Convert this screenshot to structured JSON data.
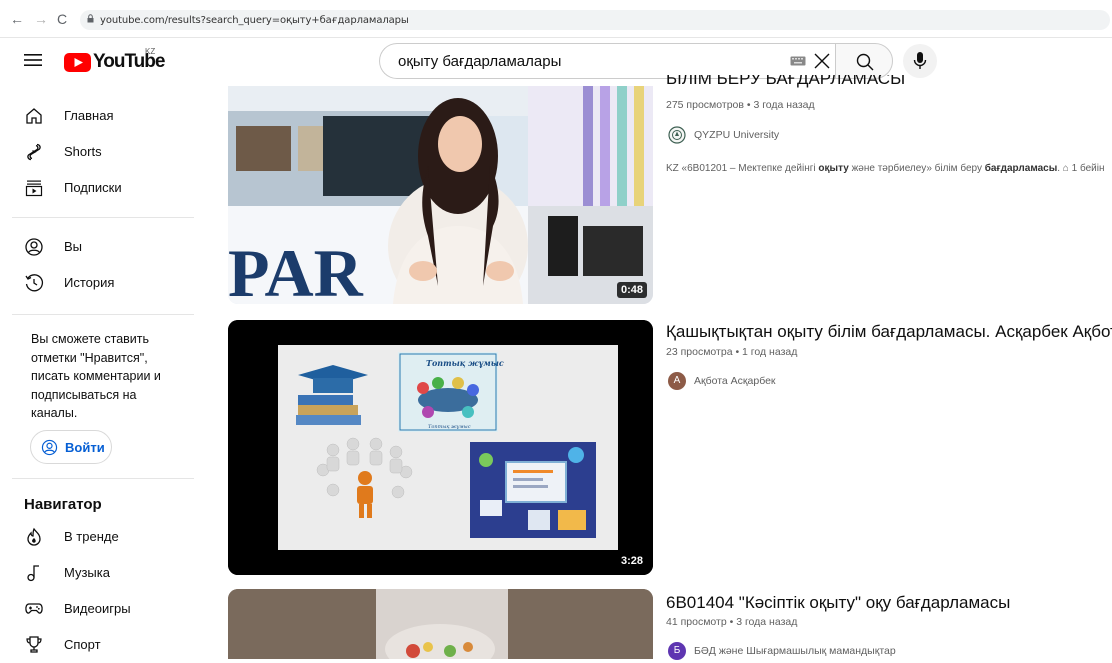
{
  "browser": {
    "url": "youtube.com/results?search_query=оқыту+бағдарламалары"
  },
  "masthead": {
    "logo_text": "YouTube",
    "country_code": "KZ",
    "search_value": "оқыту бағдарламалары"
  },
  "sidebar": {
    "main": [
      {
        "label": "Главная",
        "icon": "home-icon"
      },
      {
        "label": "Shorts",
        "icon": "shorts-icon"
      },
      {
        "label": "Подписки",
        "icon": "subscriptions-icon"
      }
    ],
    "you": [
      {
        "label": "Вы",
        "icon": "account-icon"
      },
      {
        "label": "История",
        "icon": "history-icon"
      }
    ],
    "signin_prompt": "Вы сможете ставить отметки \"Нравится\", писать комментарии и подписываться на каналы.",
    "login_label": "Войти",
    "navigator_heading": "Навигатор",
    "navigator": [
      {
        "label": "В тренде",
        "icon": "trending-icon"
      },
      {
        "label": "Музыка",
        "icon": "music-icon"
      },
      {
        "label": "Видеоигры",
        "icon": "gaming-icon"
      },
      {
        "label": "Спорт",
        "icon": "trophy-icon"
      }
    ]
  },
  "results": [
    {
      "title": "БІЛІМ БЕРУ БАҒДАРЛАМАСЫ",
      "meta": "275 просмотров • 3 года назад",
      "channel": "QYZPU University",
      "description_parts": [
        "KZ «6В01201 – Мектепке дейінгі ",
        "оқыту",
        " және тәрбиелеу» білім беру ",
        "бағдарламасы",
        ". ⌂ 1 бейін"
      ],
      "duration": "0:48",
      "thumb_text": "PAR"
    },
    {
      "title": "Қашықтықтан оқыту білім бағдарламасы. Асқарбек Ақбота",
      "meta": "23 просмотра • 1 год назад",
      "channel": "Ақбота Асқарбек",
      "channel_initial": "А",
      "duration": "3:28",
      "slide_label_top": "Топтық жұмыс",
      "slide_label_bottom": "Топтық жұмыс"
    },
    {
      "title": "6В01404 \"Кәсіптік оқыту\" оқу бағдарламасы",
      "meta": "41 просмотр • 3 года назад",
      "channel": "БӘД және Шығармашылық мамандықтар",
      "channel_initial": "Б"
    }
  ],
  "colors": {
    "brand_red": "#ff0000",
    "link_blue": "#065fd4",
    "avatar_brown": "#8d5b47",
    "avatar_purple": "#5e35b1"
  }
}
